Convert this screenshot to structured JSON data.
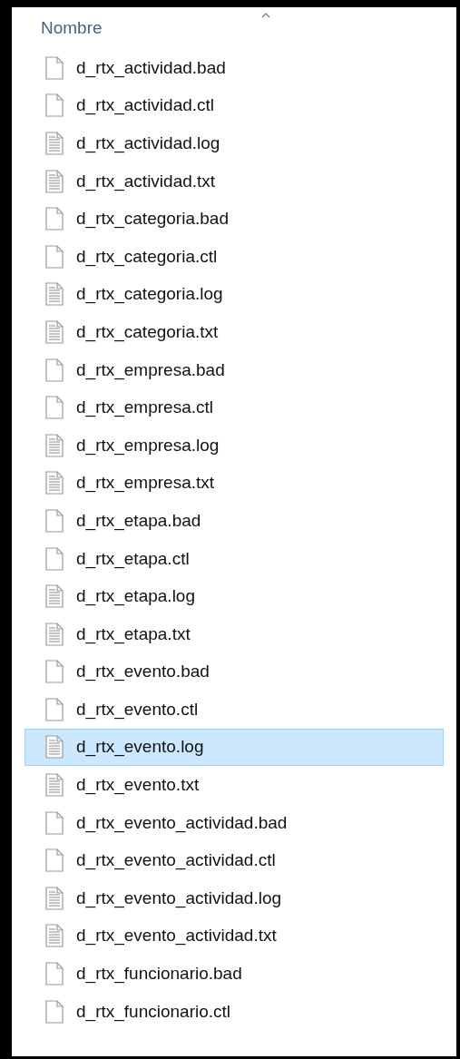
{
  "header": {
    "column": "Nombre"
  },
  "files": [
    {
      "name": "d_rtx_actividad.bad",
      "kind": "blank",
      "selected": false
    },
    {
      "name": "d_rtx_actividad.ctl",
      "kind": "blank",
      "selected": false
    },
    {
      "name": "d_rtx_actividad.log",
      "kind": "text",
      "selected": false
    },
    {
      "name": "d_rtx_actividad.txt",
      "kind": "text",
      "selected": false
    },
    {
      "name": "d_rtx_categoria.bad",
      "kind": "blank",
      "selected": false
    },
    {
      "name": "d_rtx_categoria.ctl",
      "kind": "blank",
      "selected": false
    },
    {
      "name": "d_rtx_categoria.log",
      "kind": "text",
      "selected": false
    },
    {
      "name": "d_rtx_categoria.txt",
      "kind": "text",
      "selected": false
    },
    {
      "name": "d_rtx_empresa.bad",
      "kind": "blank",
      "selected": false
    },
    {
      "name": "d_rtx_empresa.ctl",
      "kind": "blank",
      "selected": false
    },
    {
      "name": "d_rtx_empresa.log",
      "kind": "text",
      "selected": false
    },
    {
      "name": "d_rtx_empresa.txt",
      "kind": "text",
      "selected": false
    },
    {
      "name": "d_rtx_etapa.bad",
      "kind": "blank",
      "selected": false
    },
    {
      "name": "d_rtx_etapa.ctl",
      "kind": "blank",
      "selected": false
    },
    {
      "name": "d_rtx_etapa.log",
      "kind": "text",
      "selected": false
    },
    {
      "name": "d_rtx_etapa.txt",
      "kind": "text",
      "selected": false
    },
    {
      "name": "d_rtx_evento.bad",
      "kind": "blank",
      "selected": false
    },
    {
      "name": "d_rtx_evento.ctl",
      "kind": "blank",
      "selected": false
    },
    {
      "name": "d_rtx_evento.log",
      "kind": "text",
      "selected": true
    },
    {
      "name": "d_rtx_evento.txt",
      "kind": "text",
      "selected": false
    },
    {
      "name": "d_rtx_evento_actividad.bad",
      "kind": "blank",
      "selected": false
    },
    {
      "name": "d_rtx_evento_actividad.ctl",
      "kind": "blank",
      "selected": false
    },
    {
      "name": "d_rtx_evento_actividad.log",
      "kind": "text",
      "selected": false
    },
    {
      "name": "d_rtx_evento_actividad.txt",
      "kind": "text",
      "selected": false
    },
    {
      "name": "d_rtx_funcionario.bad",
      "kind": "blank",
      "selected": false
    },
    {
      "name": "d_rtx_funcionario.ctl",
      "kind": "blank",
      "selected": false
    }
  ]
}
